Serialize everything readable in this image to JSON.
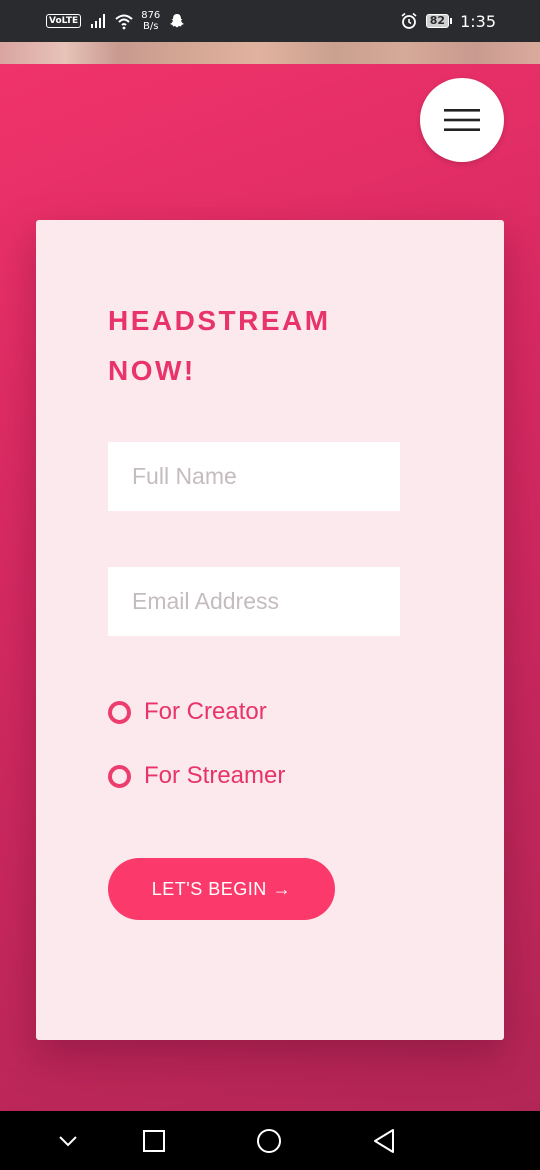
{
  "status_bar": {
    "volte": "VoLTE",
    "net_speed_value": "876",
    "net_speed_unit": "B/s",
    "battery": "82",
    "time": "1:35",
    "icons": [
      "signal-icon",
      "wifi-icon",
      "snapchat-icon",
      "alarm-icon",
      "battery-icon"
    ]
  },
  "header": {
    "menu_icon": "hamburger-menu-icon"
  },
  "form": {
    "title_line1": "HEADSTREAM",
    "title_line2": "NOW!",
    "full_name_placeholder": "Full Name",
    "email_placeholder": "Email Address",
    "radio_options": [
      {
        "label": "For Creator"
      },
      {
        "label": "For Streamer"
      }
    ],
    "submit_label": "LET'S BEGIN",
    "submit_arrow": "→"
  },
  "nav_bar": {
    "icons": [
      "chevron-down-icon",
      "recent-apps-icon",
      "home-icon",
      "back-icon"
    ]
  },
  "colors": {
    "accent": "#e8336b",
    "button": "#fb3a6b",
    "card_bg": "#fbe9ee",
    "hero_top": "#f0336a",
    "hero_bottom": "#b22655"
  }
}
